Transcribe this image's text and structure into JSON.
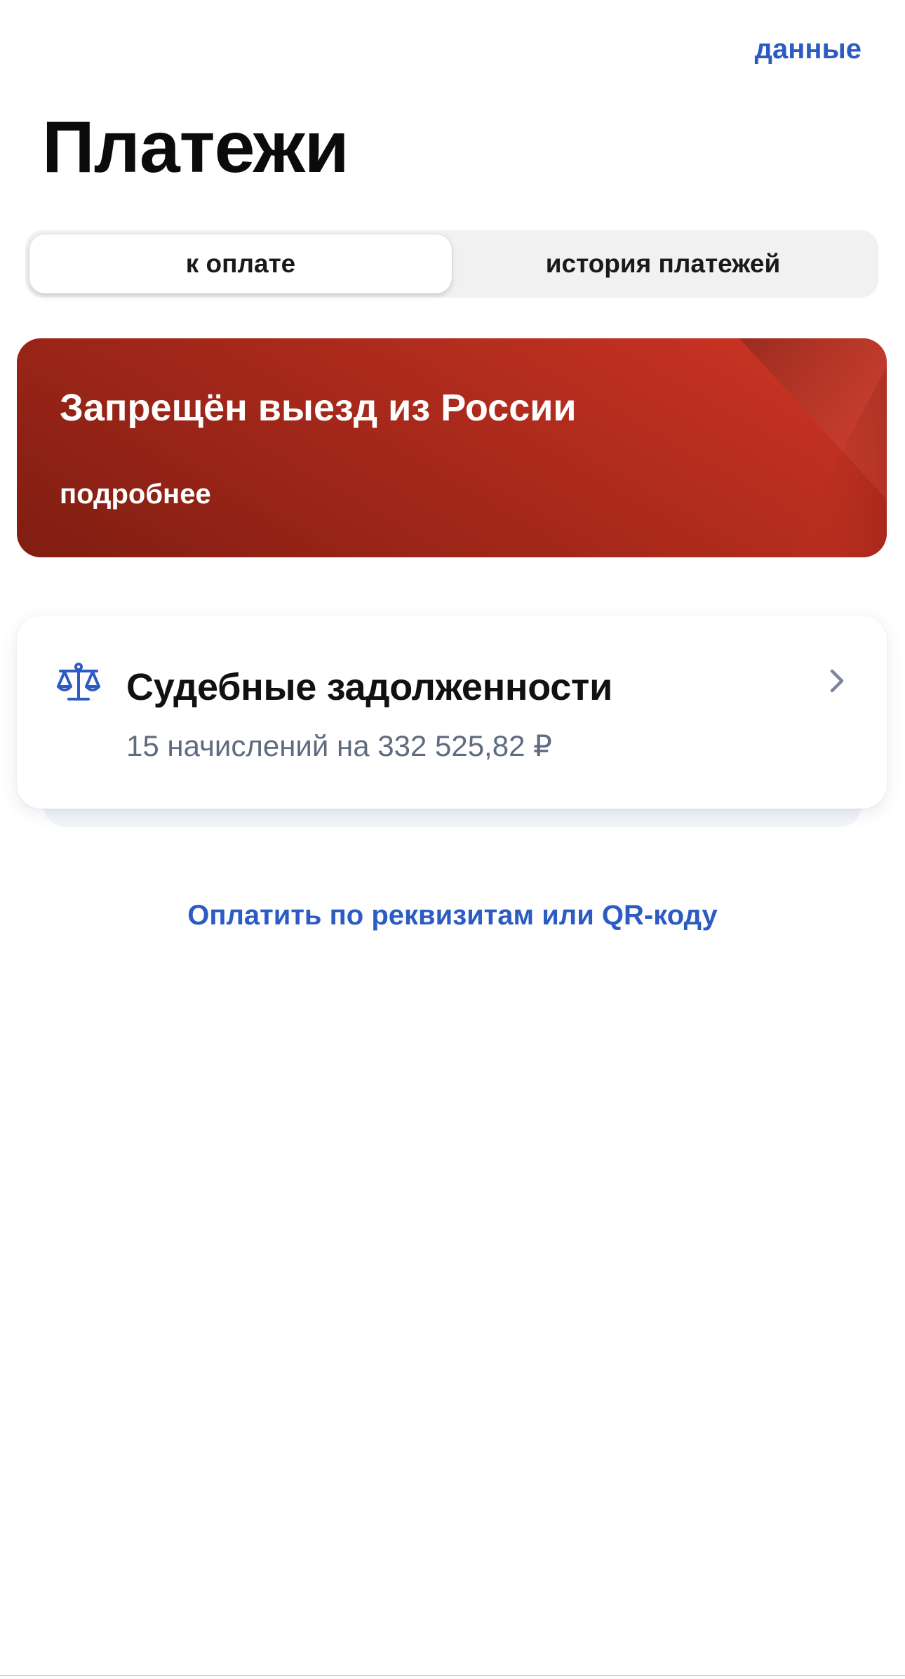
{
  "header": {
    "data_link_label": "данные",
    "title": "Платежи"
  },
  "tabs": [
    {
      "label": "к оплате",
      "active": true
    },
    {
      "label": "история платежей",
      "active": false
    }
  ],
  "banner": {
    "title": "Запрещён выезд из России",
    "link_label": "подробнее",
    "color": "#b82b1d"
  },
  "debt_card": {
    "icon": "scales-icon",
    "title": "Судебные задолженности",
    "subtitle": "15 начислений на 332 525,82 ₽"
  },
  "actions": {
    "pay_by_details_label": "Оплатить по реквизитам или QR-коду"
  },
  "colors": {
    "accent": "#2c5bc3",
    "banner_red": "#b82b1d",
    "muted_text": "#5f6b80"
  }
}
